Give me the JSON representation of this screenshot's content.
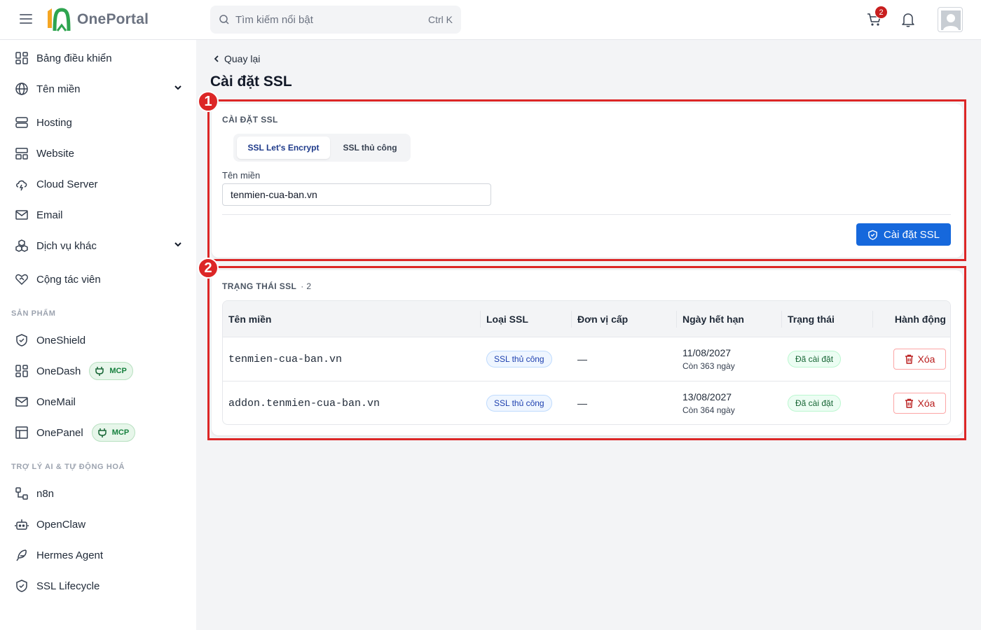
{
  "header": {
    "logo_text": "OnePortal",
    "search_placeholder": "Tìm kiếm nổi bật",
    "search_shortcut": "Ctrl K",
    "cart_count": "2"
  },
  "sidebar": {
    "items": [
      {
        "label": "Bảng điều khiển"
      },
      {
        "label": "Tên miền"
      },
      {
        "label": "Hosting"
      },
      {
        "label": "Website"
      },
      {
        "label": "Cloud Server"
      },
      {
        "label": "Email"
      },
      {
        "label": "Dịch vụ khác"
      },
      {
        "label": "Cộng tác viên"
      }
    ],
    "section_products": "SẢN PHẨM",
    "products": [
      {
        "label": "OneShield"
      },
      {
        "label": "OneDash",
        "badge": "MCP"
      },
      {
        "label": "OneMail"
      },
      {
        "label": "OnePanel",
        "badge": "MCP"
      }
    ],
    "section_ai": "TRỢ LÝ AI & TỰ ĐỘNG HOÁ",
    "ai_items": [
      {
        "label": "n8n"
      },
      {
        "label": "OpenClaw"
      },
      {
        "label": "Hermes Agent"
      },
      {
        "label": "SSL Lifecycle"
      }
    ]
  },
  "main": {
    "back_label": "Quay lại",
    "title": "Cài đặt SSL",
    "install_card": {
      "title": "CÀI ĐẶT SSL",
      "tabs": [
        "SSL Let's Encrypt",
        "SSL thủ công"
      ],
      "active_tab": "SSL Let's Encrypt",
      "domain_label": "Tên miền",
      "domain_value": "tenmien-cua-ban.vn",
      "submit_label": "Cài đặt SSL"
    },
    "status_card": {
      "title": "TRẠNG THÁI SSL",
      "count": "· 2",
      "columns": [
        "Tên miền",
        "Loại SSL",
        "Đơn vị cấp",
        "Ngày hết hạn",
        "Trạng thái",
        "Hành động"
      ],
      "rows": [
        {
          "domain": "tenmien-cua-ban.vn",
          "type": "SSL thủ công",
          "issuer": "—",
          "expiry": "11/08/2027",
          "remaining": "Còn 363 ngày",
          "status": "Đã cài đặt",
          "action": "Xóa"
        },
        {
          "domain": "addon.tenmien-cua-ban.vn",
          "type": "SSL thủ công",
          "issuer": "—",
          "expiry": "13/08/2027",
          "remaining": "Còn 364 ngày",
          "status": "Đã cài đặt",
          "action": "Xóa"
        }
      ]
    }
  },
  "annotations": [
    "1",
    "2"
  ],
  "colors": {
    "primary": "#1668dc",
    "annotation": "#dc2626",
    "logo_green": "#2ea44f",
    "logo_orange": "#f5a623"
  }
}
